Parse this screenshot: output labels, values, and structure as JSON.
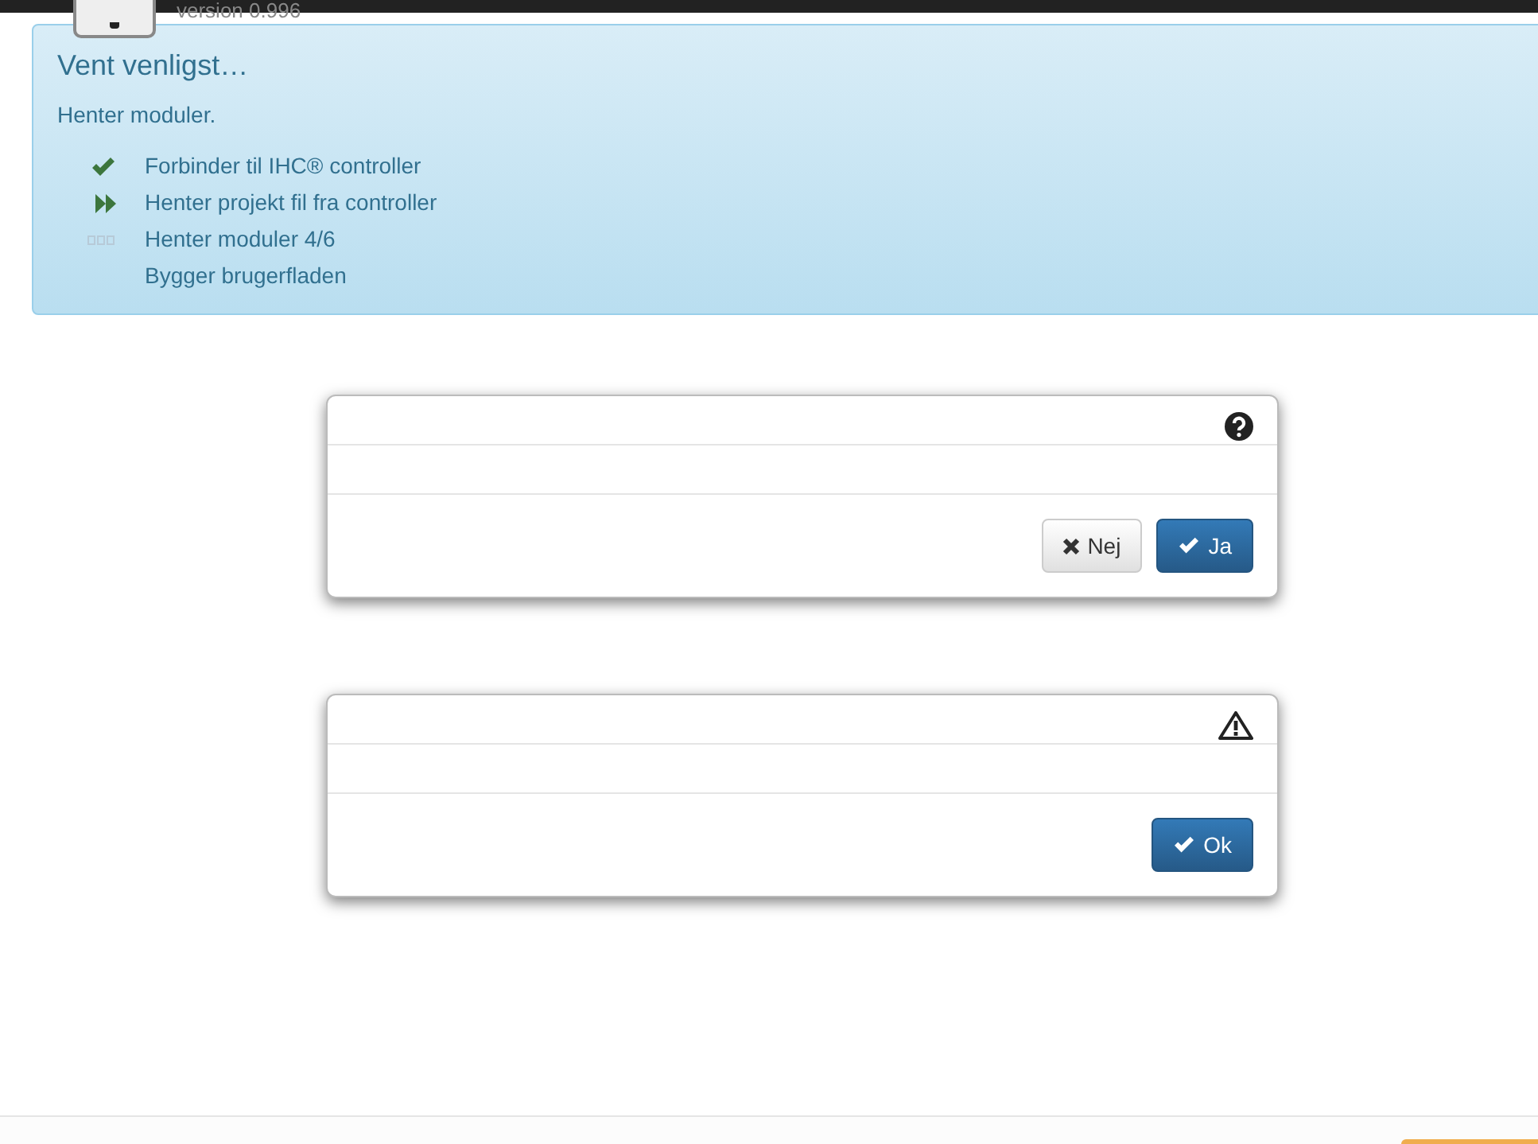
{
  "header": {
    "version": "version 0.996"
  },
  "alert": {
    "title": "Vent venligst…",
    "message": "Henter moduler.",
    "steps": [
      {
        "kind": "done",
        "label": "Forbinder til IHC® controller"
      },
      {
        "kind": "active",
        "label": "Henter projekt fil fra controller"
      },
      {
        "kind": "loading",
        "label": "Henter moduler 4/6"
      },
      {
        "kind": "pending",
        "label": "Bygger brugerfladen"
      }
    ]
  },
  "dialogs": [
    {
      "kind": "question",
      "buttons": [
        {
          "kind": "cancel",
          "label": "Nej"
        },
        {
          "kind": "confirm",
          "label": "Ja"
        }
      ]
    },
    {
      "kind": "warning",
      "buttons": [
        {
          "kind": "confirm",
          "label": "Ok"
        }
      ]
    }
  ]
}
